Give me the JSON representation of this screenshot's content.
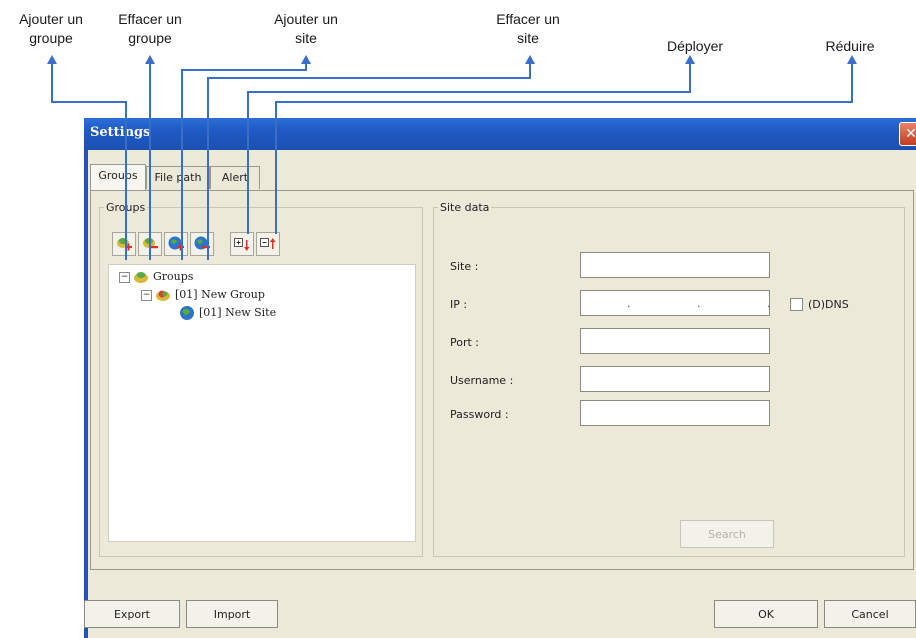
{
  "callouts": {
    "add_group": "Ajouter un\ngroupe",
    "delete_group": "Effacer un\ngroupe",
    "add_site": "Ajouter un\nsite",
    "delete_site": "Effacer un\nsite",
    "expand": "Déployer",
    "collapse": "Réduire"
  },
  "window": {
    "title": "Settings",
    "close_symbol": "✕"
  },
  "tabs": [
    "Groups",
    "File path",
    "Alert"
  ],
  "groups_panel": {
    "legend": "Groups",
    "toolbar_icons": [
      "add-group-icon",
      "delete-group-icon",
      "add-site-icon",
      "delete-site-icon",
      "expand-all-icon",
      "collapse-all-icon"
    ],
    "tree": [
      {
        "label": "Groups",
        "expander": "−"
      },
      {
        "label": "[01] New Group",
        "expander": "−"
      },
      {
        "label": "[01] New Site"
      }
    ]
  },
  "site_data": {
    "legend": "Site data",
    "site_label": "Site :",
    "site_value": "",
    "ip_label": "IP :",
    "ip_value": ".   .   .",
    "dns_label": "(D)DNS",
    "port_label": "Port :",
    "port_value": "",
    "username_label": "Username :",
    "username_value": "",
    "password_label": "Password :",
    "password_value": "",
    "search_label": "Search"
  },
  "footer": {
    "export_label": "Export",
    "import_label": "Import",
    "ok_label": "OK",
    "cancel_label": "Cancel"
  },
  "colors": {
    "title_bar": "#1f5ac4",
    "leader_lines": "#3b6fc7",
    "dialog_bg": "#ece9d8"
  }
}
